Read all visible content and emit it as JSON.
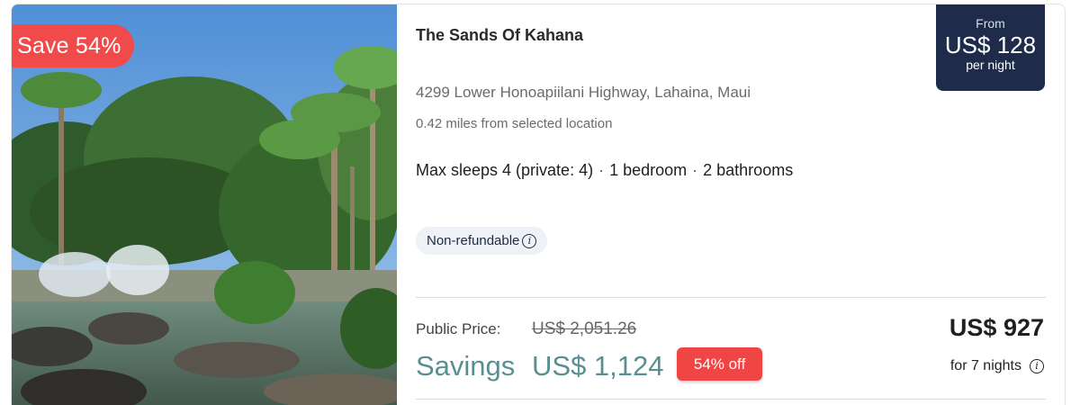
{
  "listing": {
    "save_badge": "Save 54%",
    "title": "The Sands Of Kahana",
    "address": "4299 Lower Honoapiilani Highway, Lahaina, Maui",
    "distance": "0.42 miles from selected location",
    "max_sleeps": "Max sleeps 4 (private: 4)",
    "bedrooms": "1 bedroom",
    "bathrooms": "2 bathrooms",
    "separator": "·",
    "refund_tag": "Non-refundable",
    "info_icon_glyph": "i"
  },
  "price_box": {
    "from_label": "From",
    "price": "US$ 128",
    "unit": "per night"
  },
  "pricing": {
    "public_price_label": "Public Price:",
    "public_price": "US$ 2,051.26",
    "savings_label": "Savings",
    "savings_value": "US$ 1,124",
    "discount_badge": "54% off",
    "total": "US$ 927",
    "nights_label": "for 7 nights"
  },
  "colors": {
    "save_badge": "#f04a4a",
    "price_box_bg": "#1f2b4a",
    "savings_text": "#5a8f92",
    "discount_badge": "#f04545"
  },
  "icons": {
    "info": "info-icon"
  }
}
